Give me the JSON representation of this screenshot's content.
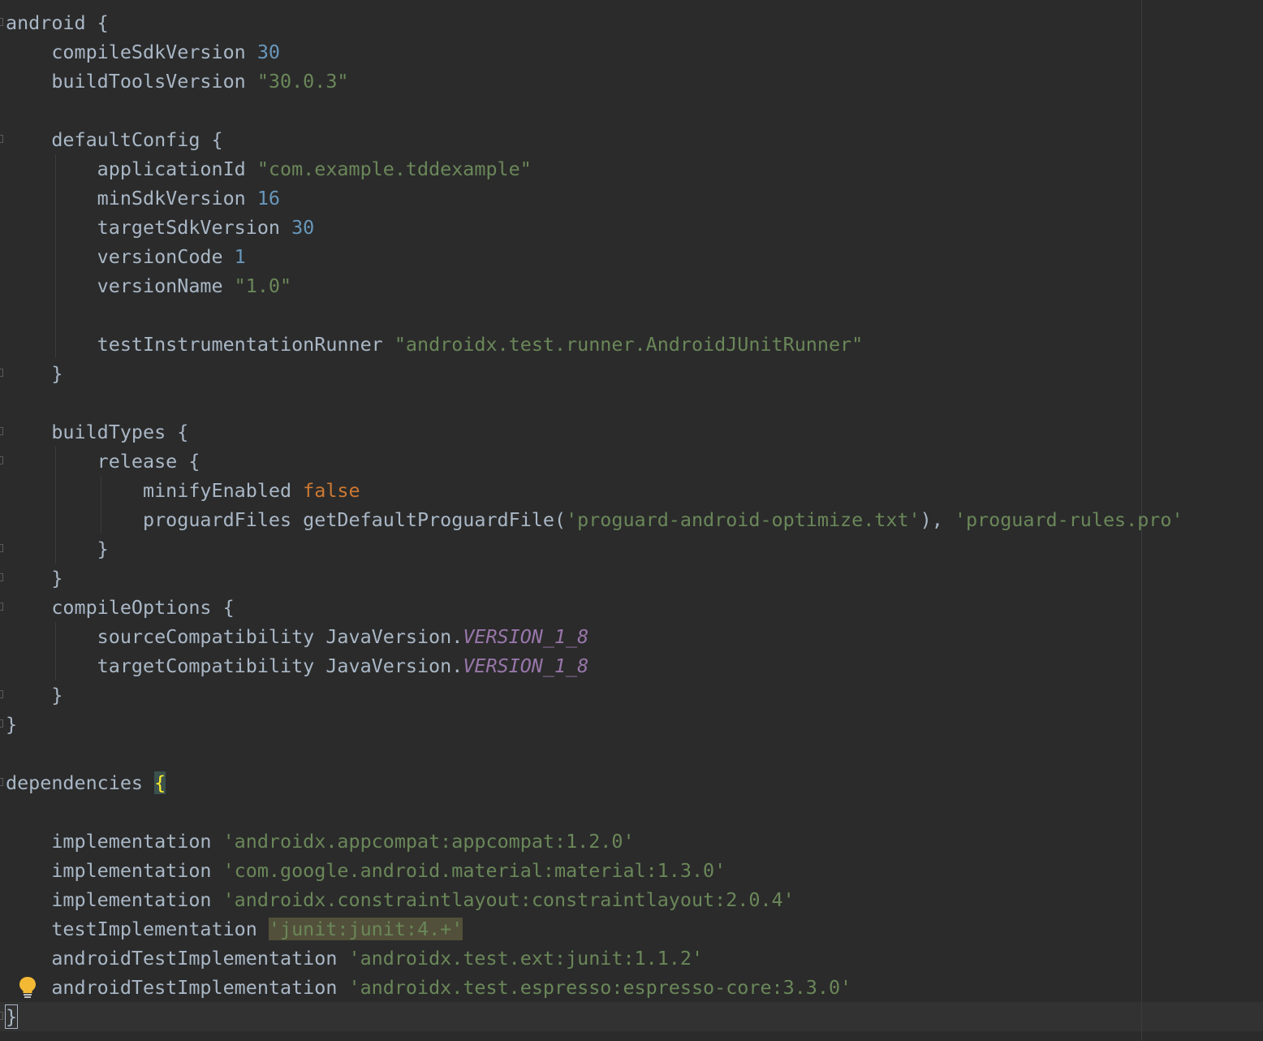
{
  "editor": {
    "lines": [
      {
        "indent": 0,
        "tokens": [
          {
            "t": "android {",
            "c": "plain"
          }
        ]
      },
      {
        "indent": 1,
        "tokens": [
          {
            "t": "compileSdkVersion ",
            "c": "plain"
          },
          {
            "t": "30",
            "c": "num"
          }
        ]
      },
      {
        "indent": 1,
        "tokens": [
          {
            "t": "buildToolsVersion ",
            "c": "plain"
          },
          {
            "t": "\"30.0.3\"",
            "c": "str"
          }
        ]
      },
      {
        "indent": 0,
        "tokens": []
      },
      {
        "indent": 1,
        "tokens": [
          {
            "t": "defaultConfig {",
            "c": "plain"
          }
        ]
      },
      {
        "indent": 2,
        "tokens": [
          {
            "t": "applicationId ",
            "c": "plain"
          },
          {
            "t": "\"com.example.tddexample\"",
            "c": "str"
          }
        ]
      },
      {
        "indent": 2,
        "tokens": [
          {
            "t": "minSdkVersion ",
            "c": "plain"
          },
          {
            "t": "16",
            "c": "num"
          }
        ]
      },
      {
        "indent": 2,
        "tokens": [
          {
            "t": "targetSdkVersion ",
            "c": "plain"
          },
          {
            "t": "30",
            "c": "num"
          }
        ]
      },
      {
        "indent": 2,
        "tokens": [
          {
            "t": "versionCode ",
            "c": "plain"
          },
          {
            "t": "1",
            "c": "num"
          }
        ]
      },
      {
        "indent": 2,
        "tokens": [
          {
            "t": "versionName ",
            "c": "plain"
          },
          {
            "t": "\"1.0\"",
            "c": "str"
          }
        ]
      },
      {
        "indent": 0,
        "tokens": []
      },
      {
        "indent": 2,
        "tokens": [
          {
            "t": "testInstrumentationRunner ",
            "c": "plain"
          },
          {
            "t": "\"androidx.test.runner.AndroidJUnitRunner\"",
            "c": "str"
          }
        ]
      },
      {
        "indent": 1,
        "tokens": [
          {
            "t": "}",
            "c": "plain"
          }
        ]
      },
      {
        "indent": 0,
        "tokens": []
      },
      {
        "indent": 1,
        "tokens": [
          {
            "t": "buildTypes {",
            "c": "plain"
          }
        ]
      },
      {
        "indent": 2,
        "tokens": [
          {
            "t": "release {",
            "c": "plain"
          }
        ]
      },
      {
        "indent": 3,
        "tokens": [
          {
            "t": "minifyEnabled ",
            "c": "plain"
          },
          {
            "t": "false",
            "c": "kw"
          }
        ]
      },
      {
        "indent": 3,
        "tokens": [
          {
            "t": "proguardFiles getDefaultProguardFile(",
            "c": "plain"
          },
          {
            "t": "'proguard-android-optimize.txt'",
            "c": "str"
          },
          {
            "t": "), ",
            "c": "plain"
          },
          {
            "t": "'proguard-rules.pro'",
            "c": "str"
          }
        ]
      },
      {
        "indent": 2,
        "tokens": [
          {
            "t": "}",
            "c": "plain"
          }
        ]
      },
      {
        "indent": 1,
        "tokens": [
          {
            "t": "}",
            "c": "plain"
          }
        ]
      },
      {
        "indent": 1,
        "tokens": [
          {
            "t": "compileOptions {",
            "c": "plain"
          }
        ]
      },
      {
        "indent": 2,
        "tokens": [
          {
            "t": "sourceCompatibility JavaVersion.",
            "c": "plain"
          },
          {
            "t": "VERSION_1_8",
            "c": "const"
          }
        ]
      },
      {
        "indent": 2,
        "tokens": [
          {
            "t": "targetCompatibility JavaVersion.",
            "c": "plain"
          },
          {
            "t": "VERSION_1_8",
            "c": "const"
          }
        ]
      },
      {
        "indent": 1,
        "tokens": [
          {
            "t": "}",
            "c": "plain"
          }
        ]
      },
      {
        "indent": 0,
        "tokens": [
          {
            "t": "}",
            "c": "plain"
          }
        ]
      },
      {
        "indent": 0,
        "tokens": []
      },
      {
        "indent": 0,
        "tokens": [
          {
            "t": "dependencies ",
            "c": "plain"
          },
          {
            "t": "{",
            "c": "brace-match"
          }
        ]
      },
      {
        "indent": 0,
        "tokens": []
      },
      {
        "indent": 1,
        "tokens": [
          {
            "t": "implementation ",
            "c": "plain"
          },
          {
            "t": "'androidx.appcompat:appcompat:1.2.0'",
            "c": "str"
          }
        ]
      },
      {
        "indent": 1,
        "tokens": [
          {
            "t": "implementation ",
            "c": "plain"
          },
          {
            "t": "'com.google.android.material:material:1.3.0'",
            "c": "str"
          }
        ]
      },
      {
        "indent": 1,
        "tokens": [
          {
            "t": "implementation ",
            "c": "plain"
          },
          {
            "t": "'androidx.constraintlayout:constraintlayout:2.0.4'",
            "c": "str"
          }
        ]
      },
      {
        "indent": 1,
        "tokens": [
          {
            "t": "testImplementation ",
            "c": "plain"
          },
          {
            "t": "'junit:junit:4.+'",
            "c": "str str-hl"
          }
        ]
      },
      {
        "indent": 1,
        "tokens": [
          {
            "t": "androidTestImplementation ",
            "c": "plain"
          },
          {
            "t": "'androidx.test.ext:junit:1.1.2'",
            "c": "str"
          }
        ]
      },
      {
        "indent": 1,
        "tokens": [
          {
            "t": "androidTestImplementation ",
            "c": "plain"
          },
          {
            "t": "'androidx.test.espresso:espresso-core:3.3.0'",
            "c": "str"
          }
        ]
      },
      {
        "indent": 0,
        "tokens": [
          {
            "t": "}",
            "c": "plain brace-caret"
          }
        ]
      }
    ]
  },
  "colors": {
    "background": "#2b2b2b",
    "caret_row": "#323232",
    "default_text": "#a9b7c6",
    "number": "#6897bb",
    "string": "#6a8759",
    "keyword": "#cc7832",
    "constant": "#9876aa",
    "brace_match": "#ffef28"
  },
  "icons": {
    "intention": "lightbulb-icon"
  }
}
